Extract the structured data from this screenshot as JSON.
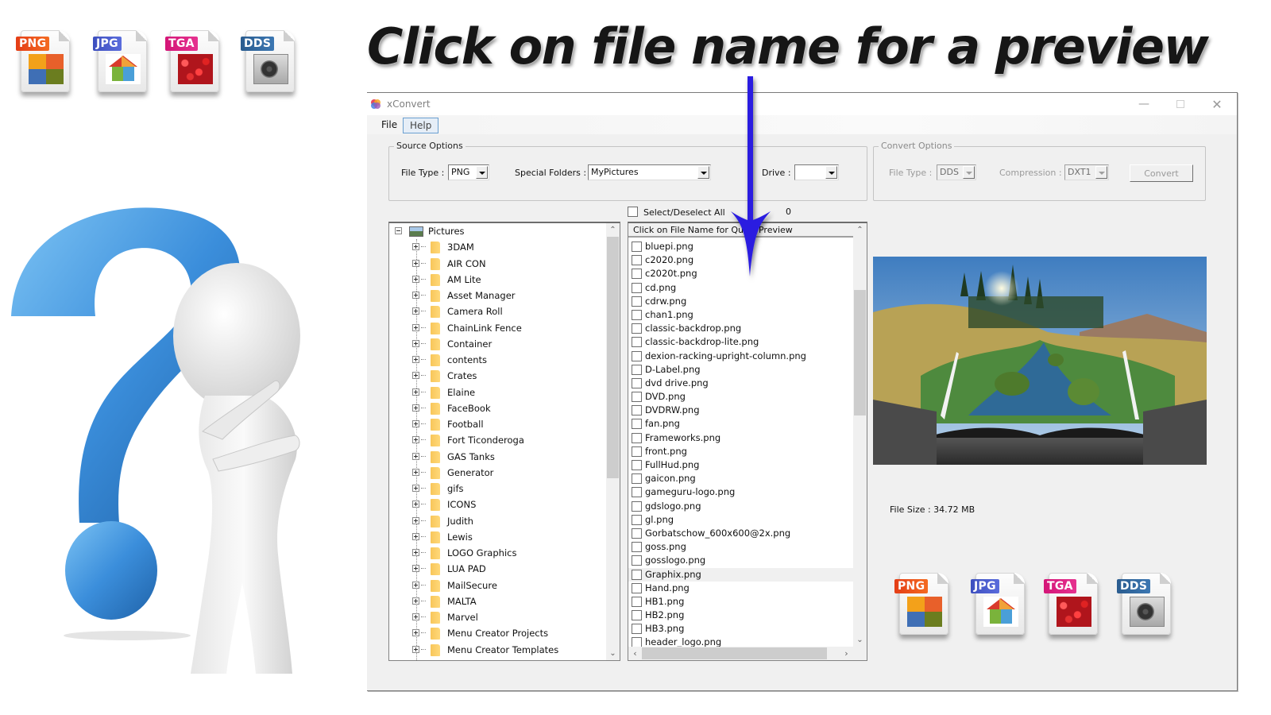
{
  "headline": "Click on file name for a preview",
  "format_badges": [
    "PNG",
    "JPG",
    "TGA",
    "DDS"
  ],
  "colors": {
    "png": "#e8451b",
    "jpg": "#4a5bcf",
    "tga": "#dc1f82",
    "dds": "#2f6aa0",
    "arrow": "#2a1de0",
    "question_mark": "#3d8fd8"
  },
  "window": {
    "title": "xConvert",
    "controls": {
      "minimize": "—",
      "maximize": "☐",
      "close": "✕"
    },
    "menu": [
      "File",
      "Help"
    ]
  },
  "source_options": {
    "legend": "Source Options",
    "file_type_label": "File Type :",
    "file_type_value": "PNG",
    "special_folders_label": "Special Folders :",
    "special_folders_value": "MyPictures",
    "drive_label": "Drive :",
    "drive_value": ""
  },
  "convert_options": {
    "legend": "Convert Options",
    "file_type_label": "File Type :",
    "file_type_value": "DDS",
    "compression_label": "Compression :",
    "compression_value": "DXT1",
    "convert_button": "Convert"
  },
  "select_all": {
    "label": "Select/Deselect All",
    "checked": false,
    "count": "0"
  },
  "tree": {
    "root": "Pictures",
    "folders": [
      "3DAM",
      "AIR CON",
      "AM Lite",
      "Asset Manager",
      "Camera Roll",
      "ChainLink Fence",
      "Container",
      "contents",
      "Crates",
      "Elaine",
      "FaceBook",
      "Football",
      "Fort Ticonderoga",
      "GAS Tanks",
      "Generator",
      "gifs",
      "ICONS",
      "Judith",
      "Lewis",
      "LOGO Graphics",
      "LUA PAD",
      "MailSecure",
      "MALTA",
      "Marvel",
      "Menu Creator Projects",
      "Menu Creator Templates"
    ]
  },
  "file_list": {
    "header": "Click on File Name for Quick Preview",
    "hovered": "Graphix.png",
    "files": [
      "bluepi.png",
      "c2020.png",
      "c2020t.png",
      "cd.png",
      "cdrw.png",
      "chan1.png",
      "classic-backdrop.png",
      "classic-backdrop-lite.png",
      "dexion-racking-upright-column.png",
      "D-Label.png",
      "dvd drive.png",
      "DVD.png",
      "DVDRW.png",
      "fan.png",
      "Frameworks.png",
      "front.png",
      "FullHud.png",
      "gaicon.png",
      "gameguru-logo.png",
      "gdslogo.png",
      "gl.png",
      "Gorbatschow_600x600@2x.png",
      "goss.png",
      "gosslogo.png",
      "Graphix.png",
      "Hand.png",
      "HB1.png",
      "HB2.png",
      "HB3.png",
      "header_logo.png"
    ]
  },
  "preview": {
    "description": "Landscape with stream and mountains rising from an open book on wooden planks",
    "file_size": "File Size : 34.72 MB"
  }
}
